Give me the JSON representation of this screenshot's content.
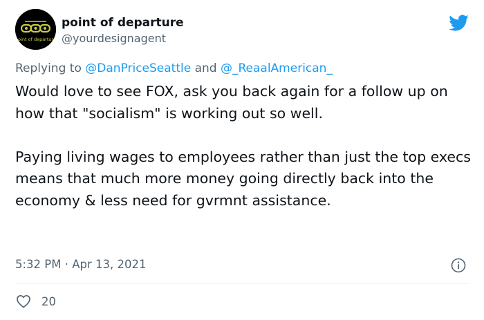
{
  "user": {
    "display_name": "point of departure",
    "handle": "@yourdesignagent",
    "avatar_text": "point of departure"
  },
  "reply": {
    "prefix": "Replying to ",
    "mention_1": "@DanPriceSeattle",
    "connector": " and ",
    "mention_2": "@_ReaalAmerican_"
  },
  "tweet": {
    "paragraph_1": "Would love to see FOX, ask you back again for a follow up on how that \"socialism\" is working out so well.",
    "paragraph_2": "Paying living wages to employees rather than just the top execs means that much more money going directly back into the economy & less need for gvrmnt assistance."
  },
  "meta": {
    "time": "5:32 PM",
    "separator": " · ",
    "date": "Apr 13, 2021"
  },
  "engagement": {
    "likes": "20"
  },
  "icons": {
    "brand": "twitter-bird-icon",
    "info": "info-icon",
    "like": "heart-icon"
  },
  "colors": {
    "brand_blue": "#1d9bf0",
    "secondary_text": "#536471",
    "primary_text": "#0f1419",
    "avatar_bg": "#000000",
    "avatar_accent": "#c9cc3f"
  }
}
